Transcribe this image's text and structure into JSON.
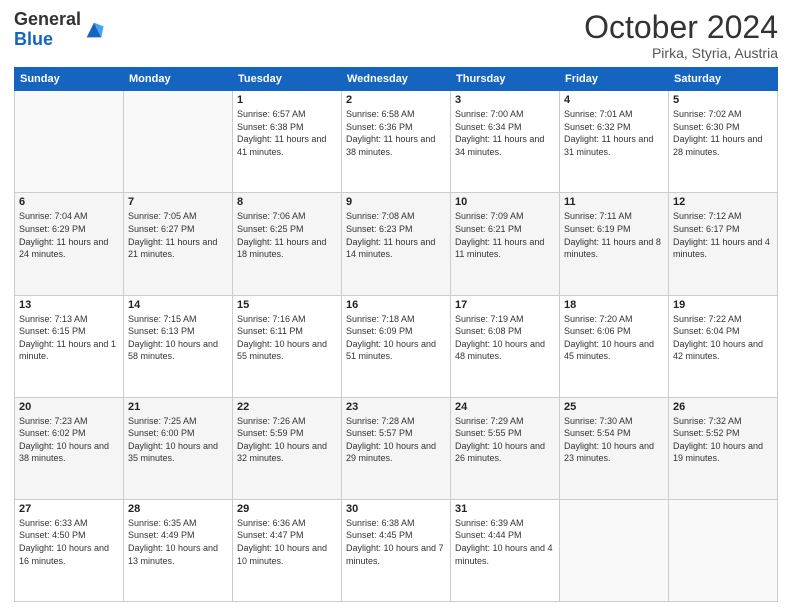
{
  "header": {
    "logo_general": "General",
    "logo_blue": "Blue",
    "month_title": "October 2024",
    "location": "Pirka, Styria, Austria"
  },
  "days_of_week": [
    "Sunday",
    "Monday",
    "Tuesday",
    "Wednesday",
    "Thursday",
    "Friday",
    "Saturday"
  ],
  "weeks": [
    [
      {
        "day": "",
        "info": ""
      },
      {
        "day": "",
        "info": ""
      },
      {
        "day": "1",
        "info": "Sunrise: 6:57 AM\nSunset: 6:38 PM\nDaylight: 11 hours and 41 minutes."
      },
      {
        "day": "2",
        "info": "Sunrise: 6:58 AM\nSunset: 6:36 PM\nDaylight: 11 hours and 38 minutes."
      },
      {
        "day": "3",
        "info": "Sunrise: 7:00 AM\nSunset: 6:34 PM\nDaylight: 11 hours and 34 minutes."
      },
      {
        "day": "4",
        "info": "Sunrise: 7:01 AM\nSunset: 6:32 PM\nDaylight: 11 hours and 31 minutes."
      },
      {
        "day": "5",
        "info": "Sunrise: 7:02 AM\nSunset: 6:30 PM\nDaylight: 11 hours and 28 minutes."
      }
    ],
    [
      {
        "day": "6",
        "info": "Sunrise: 7:04 AM\nSunset: 6:29 PM\nDaylight: 11 hours and 24 minutes."
      },
      {
        "day": "7",
        "info": "Sunrise: 7:05 AM\nSunset: 6:27 PM\nDaylight: 11 hours and 21 minutes."
      },
      {
        "day": "8",
        "info": "Sunrise: 7:06 AM\nSunset: 6:25 PM\nDaylight: 11 hours and 18 minutes."
      },
      {
        "day": "9",
        "info": "Sunrise: 7:08 AM\nSunset: 6:23 PM\nDaylight: 11 hours and 14 minutes."
      },
      {
        "day": "10",
        "info": "Sunrise: 7:09 AM\nSunset: 6:21 PM\nDaylight: 11 hours and 11 minutes."
      },
      {
        "day": "11",
        "info": "Sunrise: 7:11 AM\nSunset: 6:19 PM\nDaylight: 11 hours and 8 minutes."
      },
      {
        "day": "12",
        "info": "Sunrise: 7:12 AM\nSunset: 6:17 PM\nDaylight: 11 hours and 4 minutes."
      }
    ],
    [
      {
        "day": "13",
        "info": "Sunrise: 7:13 AM\nSunset: 6:15 PM\nDaylight: 11 hours and 1 minute."
      },
      {
        "day": "14",
        "info": "Sunrise: 7:15 AM\nSunset: 6:13 PM\nDaylight: 10 hours and 58 minutes."
      },
      {
        "day": "15",
        "info": "Sunrise: 7:16 AM\nSunset: 6:11 PM\nDaylight: 10 hours and 55 minutes."
      },
      {
        "day": "16",
        "info": "Sunrise: 7:18 AM\nSunset: 6:09 PM\nDaylight: 10 hours and 51 minutes."
      },
      {
        "day": "17",
        "info": "Sunrise: 7:19 AM\nSunset: 6:08 PM\nDaylight: 10 hours and 48 minutes."
      },
      {
        "day": "18",
        "info": "Sunrise: 7:20 AM\nSunset: 6:06 PM\nDaylight: 10 hours and 45 minutes."
      },
      {
        "day": "19",
        "info": "Sunrise: 7:22 AM\nSunset: 6:04 PM\nDaylight: 10 hours and 42 minutes."
      }
    ],
    [
      {
        "day": "20",
        "info": "Sunrise: 7:23 AM\nSunset: 6:02 PM\nDaylight: 10 hours and 38 minutes."
      },
      {
        "day": "21",
        "info": "Sunrise: 7:25 AM\nSunset: 6:00 PM\nDaylight: 10 hours and 35 minutes."
      },
      {
        "day": "22",
        "info": "Sunrise: 7:26 AM\nSunset: 5:59 PM\nDaylight: 10 hours and 32 minutes."
      },
      {
        "day": "23",
        "info": "Sunrise: 7:28 AM\nSunset: 5:57 PM\nDaylight: 10 hours and 29 minutes."
      },
      {
        "day": "24",
        "info": "Sunrise: 7:29 AM\nSunset: 5:55 PM\nDaylight: 10 hours and 26 minutes."
      },
      {
        "day": "25",
        "info": "Sunrise: 7:30 AM\nSunset: 5:54 PM\nDaylight: 10 hours and 23 minutes."
      },
      {
        "day": "26",
        "info": "Sunrise: 7:32 AM\nSunset: 5:52 PM\nDaylight: 10 hours and 19 minutes."
      }
    ],
    [
      {
        "day": "27",
        "info": "Sunrise: 6:33 AM\nSunset: 4:50 PM\nDaylight: 10 hours and 16 minutes."
      },
      {
        "day": "28",
        "info": "Sunrise: 6:35 AM\nSunset: 4:49 PM\nDaylight: 10 hours and 13 minutes."
      },
      {
        "day": "29",
        "info": "Sunrise: 6:36 AM\nSunset: 4:47 PM\nDaylight: 10 hours and 10 minutes."
      },
      {
        "day": "30",
        "info": "Sunrise: 6:38 AM\nSunset: 4:45 PM\nDaylight: 10 hours and 7 minutes."
      },
      {
        "day": "31",
        "info": "Sunrise: 6:39 AM\nSunset: 4:44 PM\nDaylight: 10 hours and 4 minutes."
      },
      {
        "day": "",
        "info": ""
      },
      {
        "day": "",
        "info": ""
      }
    ]
  ]
}
